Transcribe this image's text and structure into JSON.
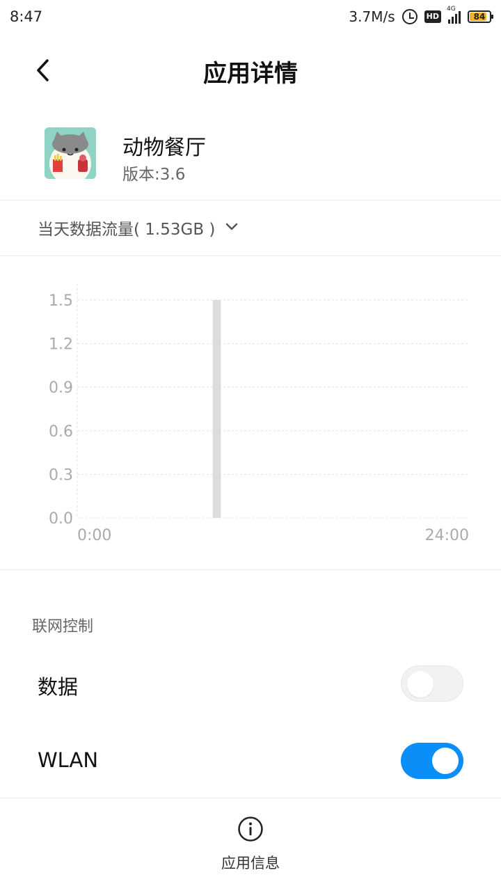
{
  "status_bar": {
    "time": "8:47",
    "net_speed": "3.7M/s",
    "hd_label": "HD",
    "network_type": "4G",
    "battery_level": "84",
    "battery_fraction": 0.84,
    "icons": [
      "alarm-icon",
      "hd-icon",
      "signal-icon",
      "battery-icon"
    ]
  },
  "header": {
    "title": "应用详情",
    "back_icon": "chevron-left-icon"
  },
  "app": {
    "name": "动物餐厅",
    "version": "版本:3.6",
    "icon": "cat-app-icon"
  },
  "usage": {
    "label": "当天数据流量( 1.53GB )",
    "dropdown_icon": "chevron-down-icon"
  },
  "chart_data": {
    "type": "bar",
    "x_axis": {
      "start_label": "0:00",
      "end_label": "24:00",
      "min": 0,
      "max": 24
    },
    "y_ticks": [
      "0.0",
      "0.3",
      "0.6",
      "0.9",
      "1.2",
      "1.5"
    ],
    "ylim": [
      0,
      1.5
    ],
    "bars": [
      {
        "hour_start": 8.3,
        "hour_end": 8.8,
        "value": 1.5
      }
    ],
    "bar_color": "#dcdcdc",
    "grid": true,
    "title": "",
    "xlabel": "",
    "ylabel": ""
  },
  "network_control": {
    "section_title": "联网控制",
    "items": [
      {
        "label": "数据",
        "enabled": false
      },
      {
        "label": "WLAN",
        "enabled": true
      }
    ],
    "accent_color": "#0a8ef8"
  },
  "bottom": {
    "label": "应用信息",
    "icon": "info-icon"
  }
}
